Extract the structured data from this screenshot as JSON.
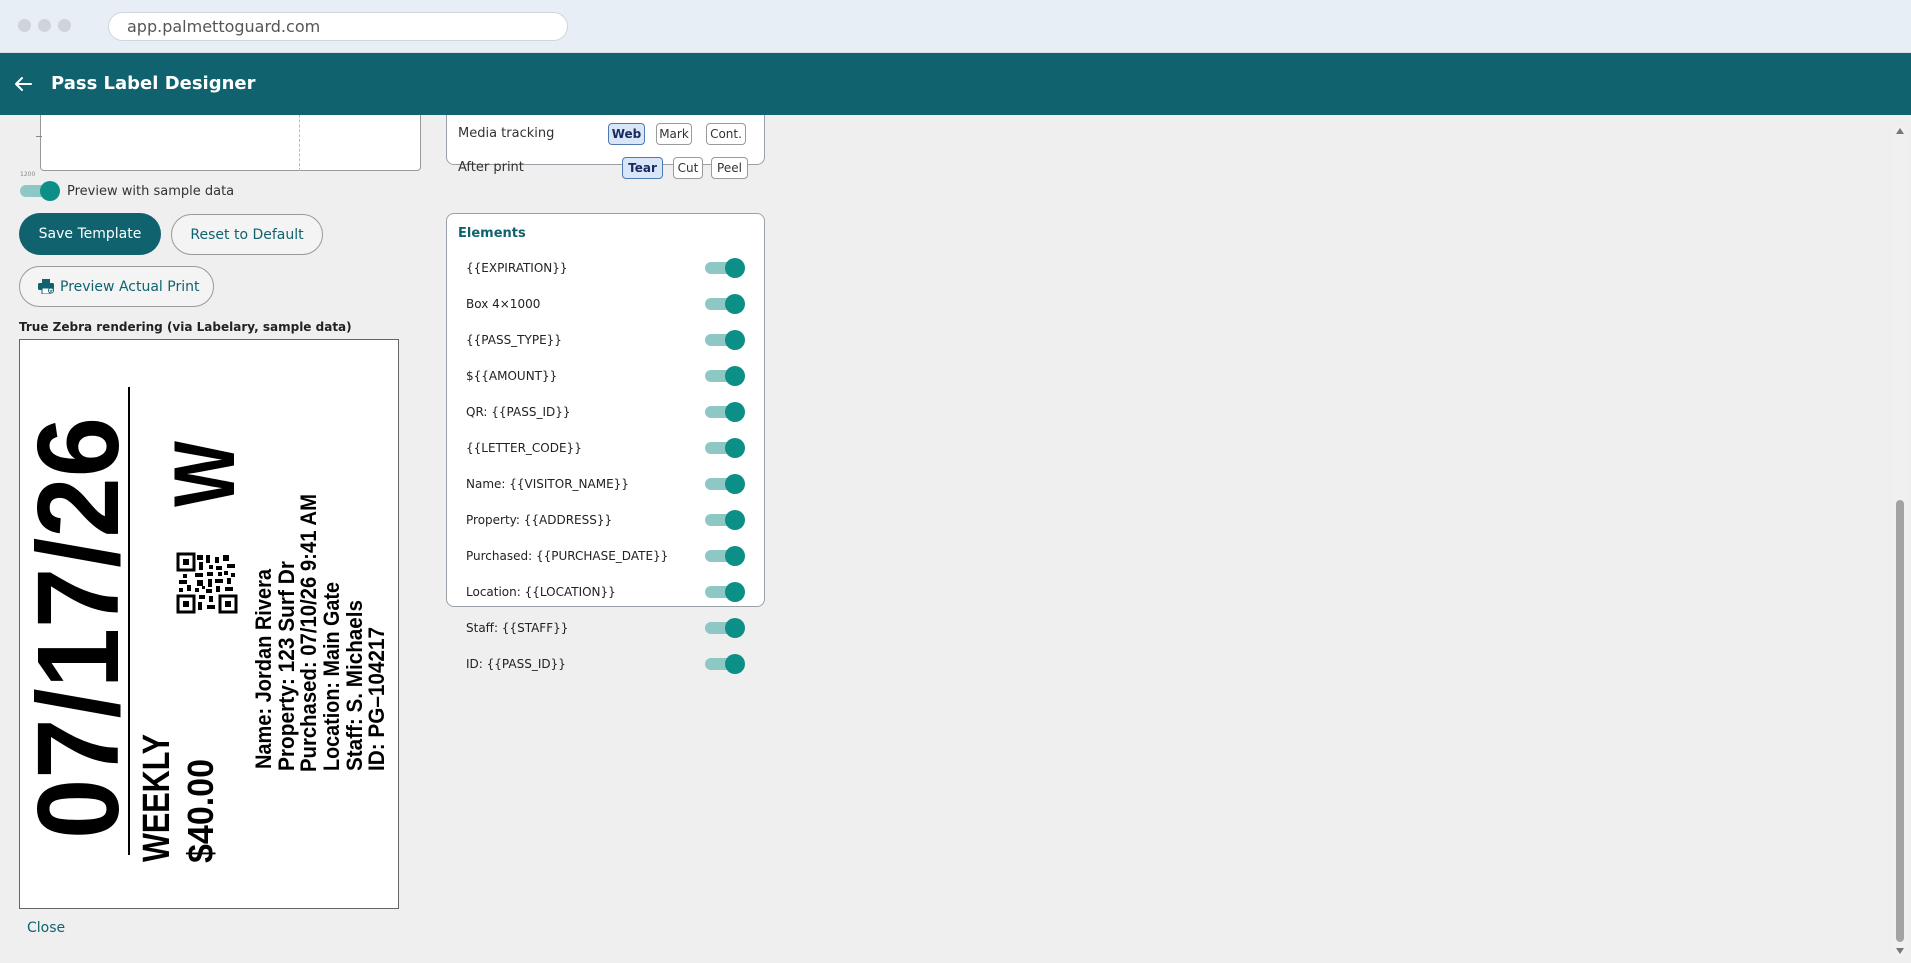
{
  "browser": {
    "url": "app.palmettoguard.com"
  },
  "header": {
    "title": "Pass Label Designer"
  },
  "preview": {
    "sample_toggle_label": "Preview with sample data",
    "sample_toggle_on": true,
    "ruler_mark": "1200"
  },
  "actions": {
    "save_label": "Save Template",
    "reset_label": "Reset to Default",
    "preview_label": "Preview Actual Print"
  },
  "zebra": {
    "title": "True Zebra rendering (via Labelary, sample data)",
    "expiration": "07/17/26",
    "letter_code": "W",
    "pass_type": "WEEKLY",
    "amount": "$40.00",
    "lines": [
      "Name: Jordan Rivera",
      "Property: 123 Surf Dr",
      "Purchased: 07/10/26 9:41 AM",
      "Location: Main Gate",
      "Staff: S. Michaels",
      "ID: PG–104217"
    ]
  },
  "close_label": "Close",
  "media": {
    "rows": [
      {
        "label": "Media tracking",
        "options": [
          "Web",
          "Mark",
          "Cont."
        ],
        "selected": "Web"
      },
      {
        "label": "After print",
        "options": [
          "Tear",
          "Cut",
          "Peel"
        ],
        "selected": "Tear"
      }
    ]
  },
  "elements": {
    "title": "Elements",
    "items": [
      {
        "label": "{{EXPIRATION}}",
        "on": true
      },
      {
        "label": "Box 4×1000",
        "on": true
      },
      {
        "label": "{{PASS_TYPE}}",
        "on": true
      },
      {
        "label": "${{AMOUNT}}",
        "on": true
      },
      {
        "label": "QR: {{PASS_ID}}",
        "on": true
      },
      {
        "label": "{{LETTER_CODE}}",
        "on": true
      },
      {
        "label": "Name: {{VISITOR_NAME}}",
        "on": true
      },
      {
        "label": "Property: {{ADDRESS}}",
        "on": true
      },
      {
        "label": "Purchased: {{PURCHASE_DATE}}",
        "on": true
      },
      {
        "label": "Location: {{LOCATION}}",
        "on": true
      },
      {
        "label": "Staff: {{STAFF}}",
        "on": true
      },
      {
        "label": "ID: {{PASS_ID}}",
        "on": true
      }
    ]
  },
  "colors": {
    "brand": "#10626f",
    "toggle_on": "#0b8f86",
    "segment_active": "#d8e6f7"
  }
}
